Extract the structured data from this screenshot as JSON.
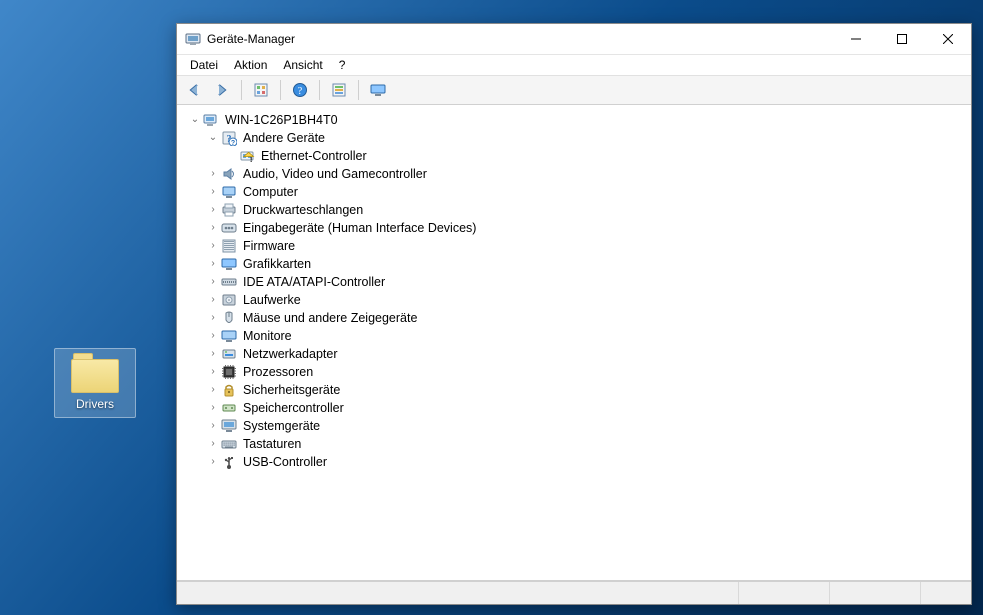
{
  "desktop": {
    "icon": {
      "label": "Drivers",
      "selected": true
    }
  },
  "window": {
    "title": "Geräte-Manager",
    "menus": [
      "Datei",
      "Aktion",
      "Ansicht",
      "?"
    ],
    "toolbar": [
      {
        "name": "back-icon"
      },
      {
        "name": "forward-icon"
      },
      {
        "sep": true
      },
      {
        "name": "show-hidden-icon"
      },
      {
        "sep": true
      },
      {
        "name": "help-icon"
      },
      {
        "sep": true
      },
      {
        "name": "scan-icon"
      },
      {
        "sep": true
      },
      {
        "name": "monitor-icon"
      }
    ]
  },
  "tree": {
    "root": {
      "label": "WIN-1C26P1BH4T0",
      "icon": "computer",
      "expanded": true,
      "children": [
        {
          "label": "Andere Geräte",
          "icon": "unknown",
          "expanded": true,
          "overlay": "question",
          "children": [
            {
              "label": "Ethernet-Controller",
              "icon": "unknown-device",
              "overlay": "warning"
            }
          ]
        },
        {
          "label": "Audio, Video und Gamecontroller",
          "icon": "audio",
          "expanded": false,
          "children": true
        },
        {
          "label": "Computer",
          "icon": "computer-cat",
          "expanded": false,
          "children": true
        },
        {
          "label": "Druckwarteschlangen",
          "icon": "printer",
          "expanded": false,
          "children": true
        },
        {
          "label": "Eingabegeräte (Human Interface Devices)",
          "icon": "hid",
          "expanded": false,
          "children": true
        },
        {
          "label": "Firmware",
          "icon": "firmware",
          "expanded": false,
          "children": true
        },
        {
          "label": "Grafikkarten",
          "icon": "display",
          "expanded": false,
          "children": true
        },
        {
          "label": "IDE ATA/ATAPI-Controller",
          "icon": "ide",
          "expanded": false,
          "children": true
        },
        {
          "label": "Laufwerke",
          "icon": "disk",
          "expanded": false,
          "children": true
        },
        {
          "label": "Mäuse und andere Zeigegeräte",
          "icon": "mouse",
          "expanded": false,
          "children": true
        },
        {
          "label": "Monitore",
          "icon": "monitor",
          "expanded": false,
          "children": true
        },
        {
          "label": "Netzwerkadapter",
          "icon": "network",
          "expanded": false,
          "children": true
        },
        {
          "label": "Prozessoren",
          "icon": "cpu",
          "expanded": false,
          "children": true
        },
        {
          "label": "Sicherheitsgeräte",
          "icon": "security",
          "expanded": false,
          "children": true
        },
        {
          "label": "Speichercontroller",
          "icon": "storage",
          "expanded": false,
          "children": true
        },
        {
          "label": "Systemgeräte",
          "icon": "system",
          "expanded": false,
          "children": true
        },
        {
          "label": "Tastaturen",
          "icon": "keyboard",
          "expanded": false,
          "children": true
        },
        {
          "label": "USB-Controller",
          "icon": "usb",
          "expanded": false,
          "children": true
        }
      ]
    }
  }
}
